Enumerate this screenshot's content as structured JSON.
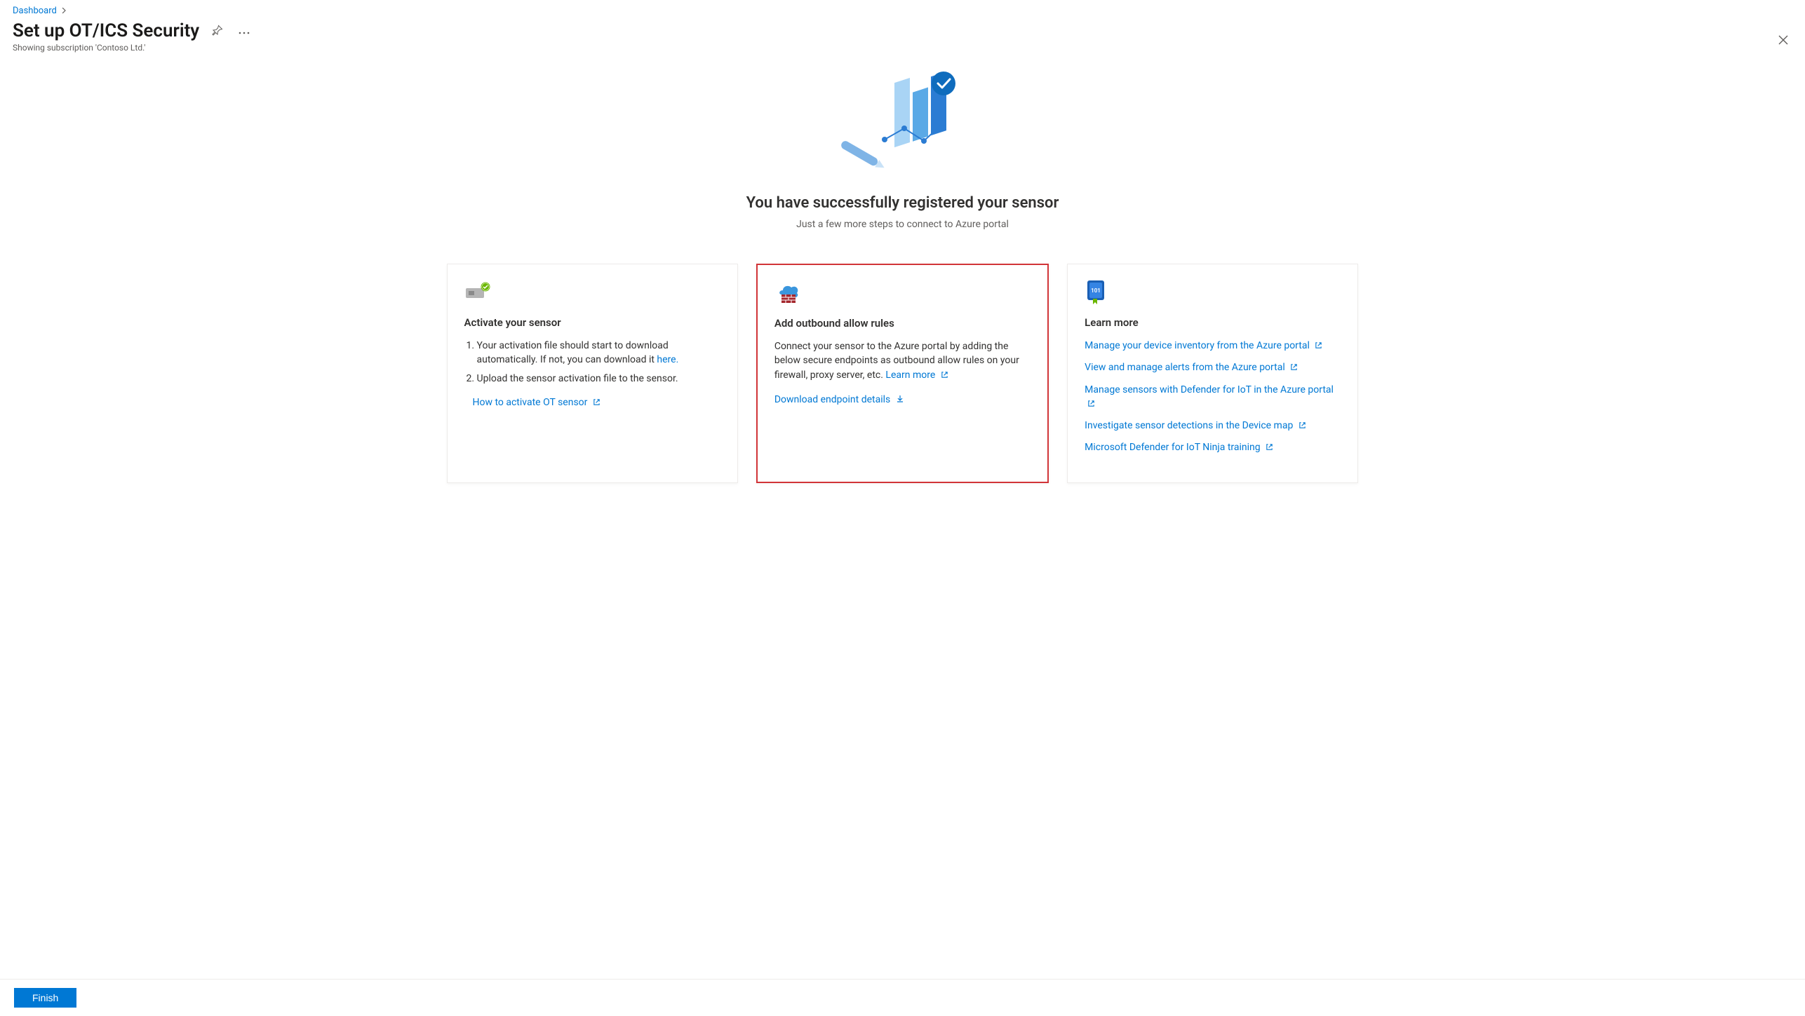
{
  "breadcrumb": {
    "items": [
      {
        "label": "Dashboard"
      }
    ]
  },
  "page": {
    "title": "Set up OT/ICS Security",
    "subtitle": "Showing subscription 'Contoso Ltd.'"
  },
  "success": {
    "heading": "You have successfully registered your sensor",
    "sub": "Just a few more steps to connect to Azure portal"
  },
  "cards": {
    "activate": {
      "title": "Activate your sensor",
      "step1_prefix": "Your activation file should start to download automatically. If not, you can download it ",
      "step1_link": "here.",
      "step2": "Upload the sensor activation file to the sensor.",
      "how_link": "How to activate OT sensor"
    },
    "outbound": {
      "title": "Add outbound allow rules",
      "body_prefix": "Connect your sensor to the Azure portal by adding the below secure endpoints as outbound allow rules on your firewall, proxy server, etc. ",
      "learn_more": "Learn more",
      "download_link": "Download endpoint details"
    },
    "learn": {
      "title": "Learn more",
      "links": [
        "Manage your device inventory from the Azure portal",
        "View and manage alerts from the Azure portal",
        "Manage sensors with Defender for IoT in the Azure portal",
        "Investigate sensor detections in the Device map",
        "Microsoft Defender for IoT Ninja training"
      ]
    }
  },
  "footer": {
    "finish": "Finish"
  }
}
